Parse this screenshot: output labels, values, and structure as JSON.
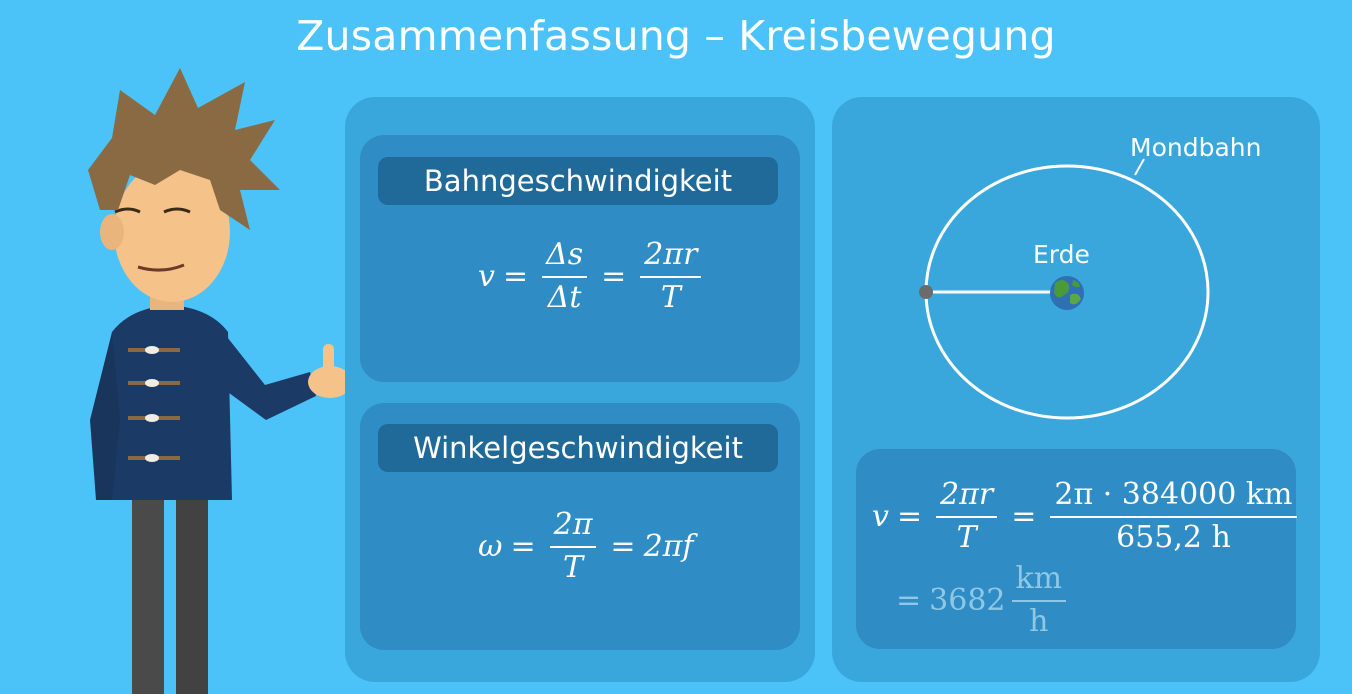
{
  "title": "Zusammenfassung – Kreisbewegung",
  "bahn": {
    "label": "Bahngeschwindigkeit",
    "formula": {
      "lhs": "v",
      "eq": "=",
      "f1_num": "Δs",
      "f1_den": "Δt",
      "f2_num": "2πr",
      "f2_den": "T"
    }
  },
  "winkel": {
    "label": "Winkelgeschwindigkeit",
    "formula": {
      "lhs": "ω",
      "eq": "=",
      "f1_num": "2π",
      "f1_den": "T",
      "rhs": "2πf"
    }
  },
  "diagram": {
    "orbit_label": "Mondbahn",
    "earth_label": "Erde"
  },
  "calc": {
    "lhs": "v",
    "eq": "=",
    "f1_num": "2πr",
    "f1_den": "T",
    "f2_num": "2π · 384000 km",
    "f2_den": "655,2 h",
    "result_value": "3682",
    "result_unit_num": "km",
    "result_unit_den": "h"
  },
  "colors": {
    "background": "#4bc3f8",
    "panel": "#3aa7dc",
    "card": "#2f8cc4",
    "label_box": "#1f6a99"
  }
}
